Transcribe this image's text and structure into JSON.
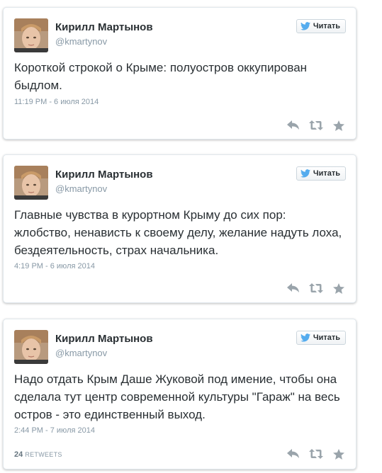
{
  "tweets": [
    {
      "author_name": "Кирилл Мартынов",
      "author_handle": "@kmartynov",
      "follow_label": "Читать",
      "text": "Короткой строкой о Крыме: полуостров оккупирован быдлом.",
      "date": "11:19 PM - 6 июля 2014"
    },
    {
      "author_name": "Кирилл Мартынов",
      "author_handle": "@kmartynov",
      "follow_label": "Читать",
      "text": "Главные чувства в курортном Крыму до сих пор: жлобство, ненависть к своему делу, желание надуть лоха, бездеятельность, страх начальника.",
      "date": "4:19 PM - 6 июля 2014"
    },
    {
      "author_name": "Кирилл Мартынов",
      "author_handle": "@kmartynov",
      "follow_label": "Читать",
      "text": "Надо отдать Крым Даше Жуковой под имение, чтобы она сделала тут центр современной культуры \"Гараж\" на весь остров - это единственный выход.",
      "date": "2:44 PM - 7 июля 2014",
      "retweet_count": "24",
      "retweet_label": "RETWEETS"
    }
  ],
  "colors": {
    "twitter_blue": "#55acee",
    "action_gray": "#9aa4ab",
    "text": "#292f33",
    "muted": "#8899a6"
  },
  "icons": [
    "twitter-bird-icon",
    "reply-icon",
    "retweet-icon",
    "favorite-icon"
  ]
}
